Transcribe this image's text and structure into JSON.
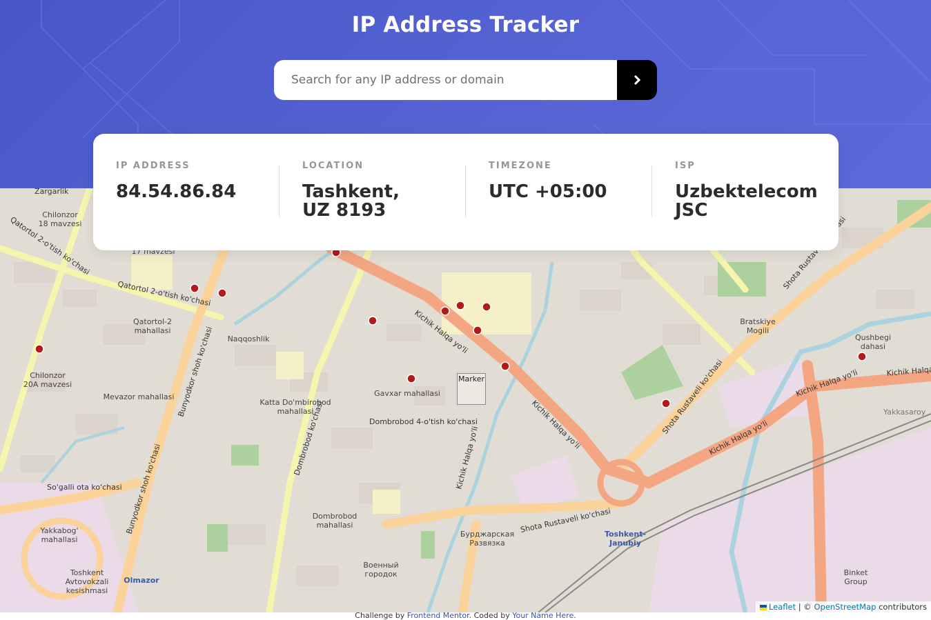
{
  "page": {
    "title": "IP Address Tracker"
  },
  "search": {
    "placeholder": "Search for any IP address or domain",
    "value": "",
    "button_icon": "chevron-right-icon"
  },
  "stats": [
    {
      "label": "IP ADDRESS",
      "value": "84.54.86.84"
    },
    {
      "label": "LOCATION",
      "value": "Tashkent, UZ 8193"
    },
    {
      "label": "TIMEZONE",
      "value": "UTC +05:00"
    },
    {
      "label": "ISP",
      "value": "Uzbektelecom JSC"
    }
  ],
  "map": {
    "marker_label": "Marker",
    "labels": [
      "Chilonzor 18 mavzesi",
      "Qatortol 2-o'tish ko'chasi",
      "Qatortol-2 mahallasi",
      "Naqqoshlik",
      "Katta Do'mbirobod mahallasi",
      "Gavxar mahallasi",
      "Mevazor mahallasi",
      "Chilonzor 20A mavzesi",
      "Yakkabog' mahallasi",
      "Dombrobod mahallasi",
      "Toshkent Avtovokzali kesishmasi",
      "Olmazor",
      "Bratskiye Mogili",
      "Qushbegi dahasi",
      "Toshkent-Janubiy",
      "Kichik Halqa yo'li",
      "Shota Rustaveli ko'chasi",
      "Bunyodkor shoh ko'chasi",
      "Dombrobod ko'chasi",
      "So'galli ota ko'chasi",
      "Бурджарская Развязка",
      "Военный городок",
      "Binket Group",
      "Zargarlik",
      "17 mavzesi",
      "Dombrobod 4-o'tish ko'chasi",
      "Yakkasaroy"
    ],
    "colors": {
      "background": "#e6e0d6",
      "major_road": "#f4a582",
      "secondary_road": "#fbd39a",
      "tertiary_road": "#f6f5ae",
      "water": "#aad3df",
      "park": "#add19e",
      "industrial": "#ebdbe8",
      "hospital_marker": "#b31a1a"
    }
  },
  "attribution": {
    "leaflet": "Leaflet",
    "separator": "| ©",
    "osm": "OpenStreetMap",
    "suffix": "contributors"
  },
  "footer": {
    "prefix": "Challenge by",
    "fm_link": "Frontend Mentor",
    "middle": ". Coded by",
    "author_link": "Your Name Here",
    "end": "."
  }
}
